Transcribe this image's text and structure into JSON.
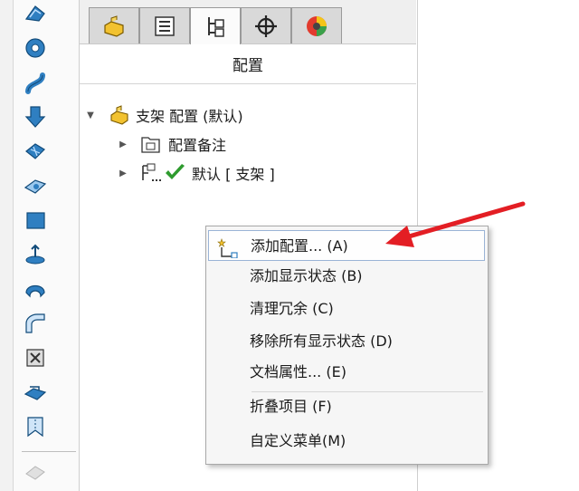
{
  "panel": {
    "title": "配置",
    "tabs": [
      {
        "icon": "part-icon"
      },
      {
        "icon": "property-manager-icon"
      },
      {
        "icon": "configuration-manager-icon",
        "active": true
      },
      {
        "icon": "dimxpert-icon"
      },
      {
        "icon": "display-manager-icon"
      }
    ]
  },
  "tree": {
    "root_label": "支架 配置  (默认)",
    "items": [
      {
        "label": "配置备注",
        "icon": "folder-icon"
      },
      {
        "label": "默认 [ 支架 ]",
        "icon": "configuration-icon",
        "status": "active-checkmark"
      }
    ]
  },
  "left_toolbar": {
    "tools": [
      "sweep-icon",
      "revolve-icon",
      "swept-boss-icon",
      "extruded-cut-icon",
      "loft-icon",
      "surface-icon",
      "plate-icon",
      "fillet-icon",
      "shell-icon",
      "bend-icon",
      "wrap-icon",
      "flex-icon",
      "zip-icon",
      "disabled-feature-icon"
    ]
  },
  "context_menu": {
    "items": [
      {
        "label": "添加配置... (A)",
        "highlighted": true,
        "icon": "add-configuration-icon"
      },
      {
        "label": "添加显示状态 (B)"
      },
      {
        "label": "清理冗余 (C)"
      },
      {
        "label": "移除所有显示状态 (D)"
      },
      {
        "label": "文档属性... (E)"
      },
      {
        "label": "折叠项目 (F)"
      },
      {
        "label": "自定义菜单(M)"
      }
    ]
  },
  "colors": {
    "accent_arrow": "#e31e24",
    "check_green": "#2e9b2e",
    "tool_blue": "#2f7fc1"
  }
}
